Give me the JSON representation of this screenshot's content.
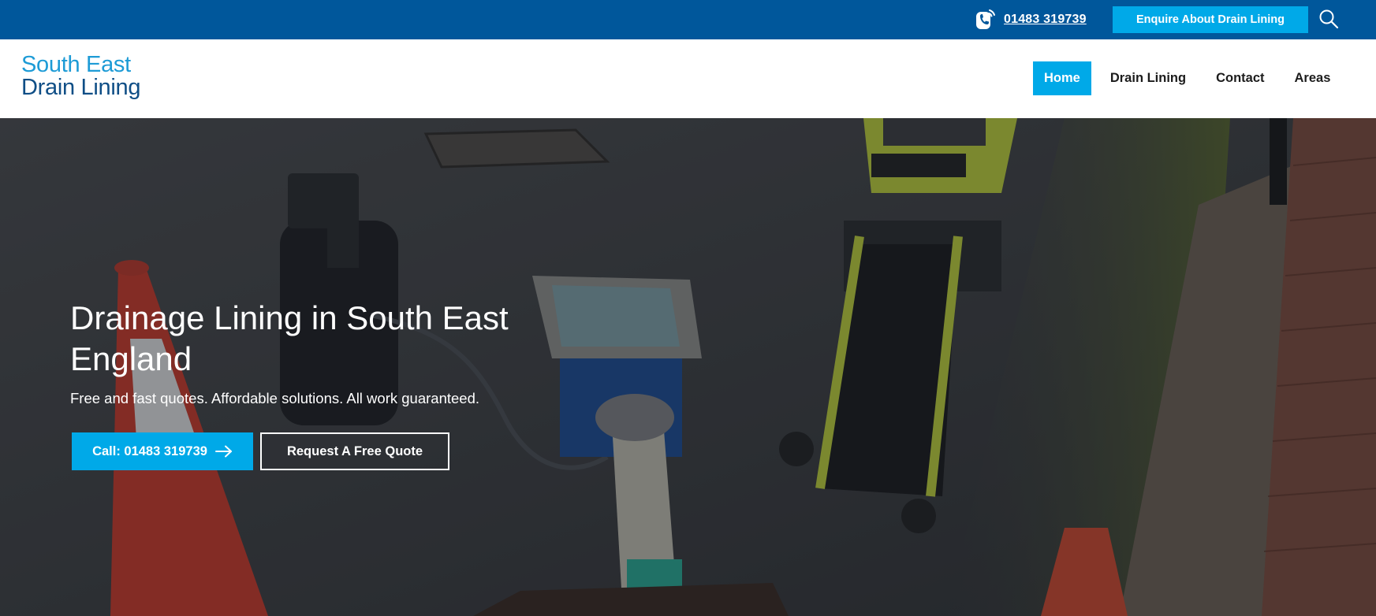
{
  "topbar": {
    "phone": "01483 319739",
    "enquire_label": "Enquire About Drain Lining",
    "icons": {
      "phone": "phone-ring-icon",
      "search": "search-icon"
    }
  },
  "header": {
    "logo_line1": "South East",
    "logo_line2": "Drain Lining",
    "nav": [
      {
        "label": "Home",
        "active": true
      },
      {
        "label": "Drain Lining",
        "active": false
      },
      {
        "label": "Contact",
        "active": false
      },
      {
        "label": "Areas",
        "active": false
      }
    ]
  },
  "hero": {
    "title_line1": "Drainage Lining in South East",
    "title_line2": "England",
    "subtitle": "Free and fast quotes. Affordable solutions. All work guaranteed.",
    "call_label": "Call: 01483 319739",
    "quote_label": "Request A Free Quote"
  },
  "colors": {
    "topbar": "#00579b",
    "accent": "#00a9e8",
    "logo_light": "#1d9bd6",
    "logo_dark": "#0f4e86",
    "nav_text": "#1c1c1c"
  }
}
